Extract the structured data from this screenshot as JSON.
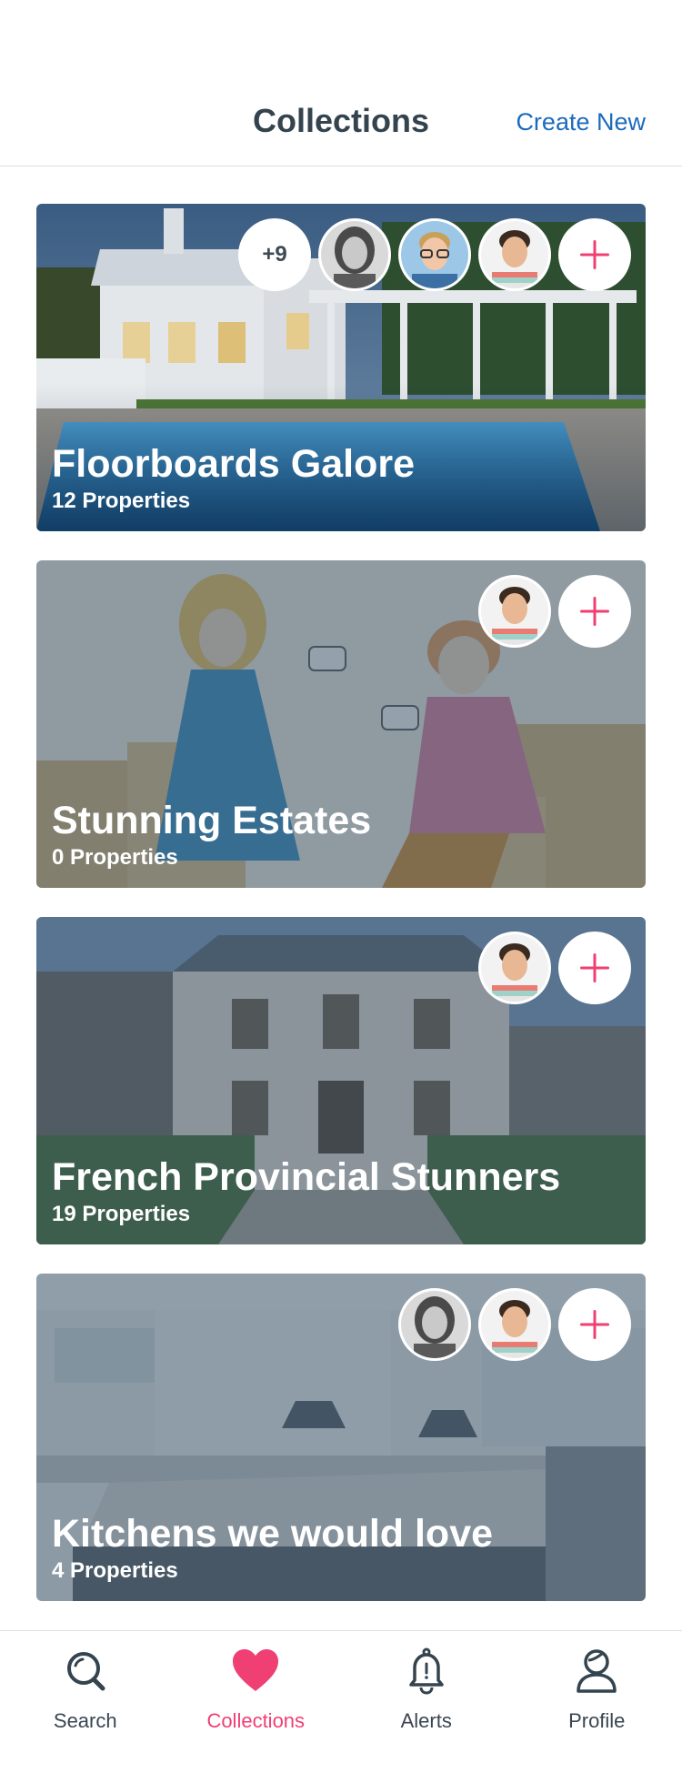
{
  "header": {
    "title": "Collections",
    "create_new_label": "Create New"
  },
  "collections": [
    {
      "title": "Floorboards Galore",
      "count_label": "12 Properties",
      "extra_members_label": "+9",
      "members": [
        "woman-avatar",
        "glasses-man-avatar",
        "man-avatar"
      ],
      "image": "pool-house-photo"
    },
    {
      "title": "Stunning Estates",
      "count_label": "0 Properties",
      "members": [
        "man-avatar"
      ],
      "image": "couple-illustration"
    },
    {
      "title": "French Provincial Stunners",
      "count_label": "19 Properties",
      "members": [
        "man-avatar"
      ],
      "image": "mansion-photo"
    },
    {
      "title": "Kitchens we would love",
      "count_label": "4 Properties",
      "members": [
        "woman-avatar",
        "man-avatar"
      ],
      "image": "kitchen-photo"
    }
  ],
  "tabs": [
    {
      "label": "Search",
      "icon": "search-icon",
      "active": false
    },
    {
      "label": "Collections",
      "icon": "heart-icon",
      "active": true
    },
    {
      "label": "Alerts",
      "icon": "bell-icon",
      "active": false
    },
    {
      "label": "Profile",
      "icon": "profile-icon",
      "active": false
    }
  ],
  "colors": {
    "accent": "#f03f73",
    "link": "#1b6bbd",
    "text": "#34444f",
    "card_overlay": "#3c5468"
  }
}
